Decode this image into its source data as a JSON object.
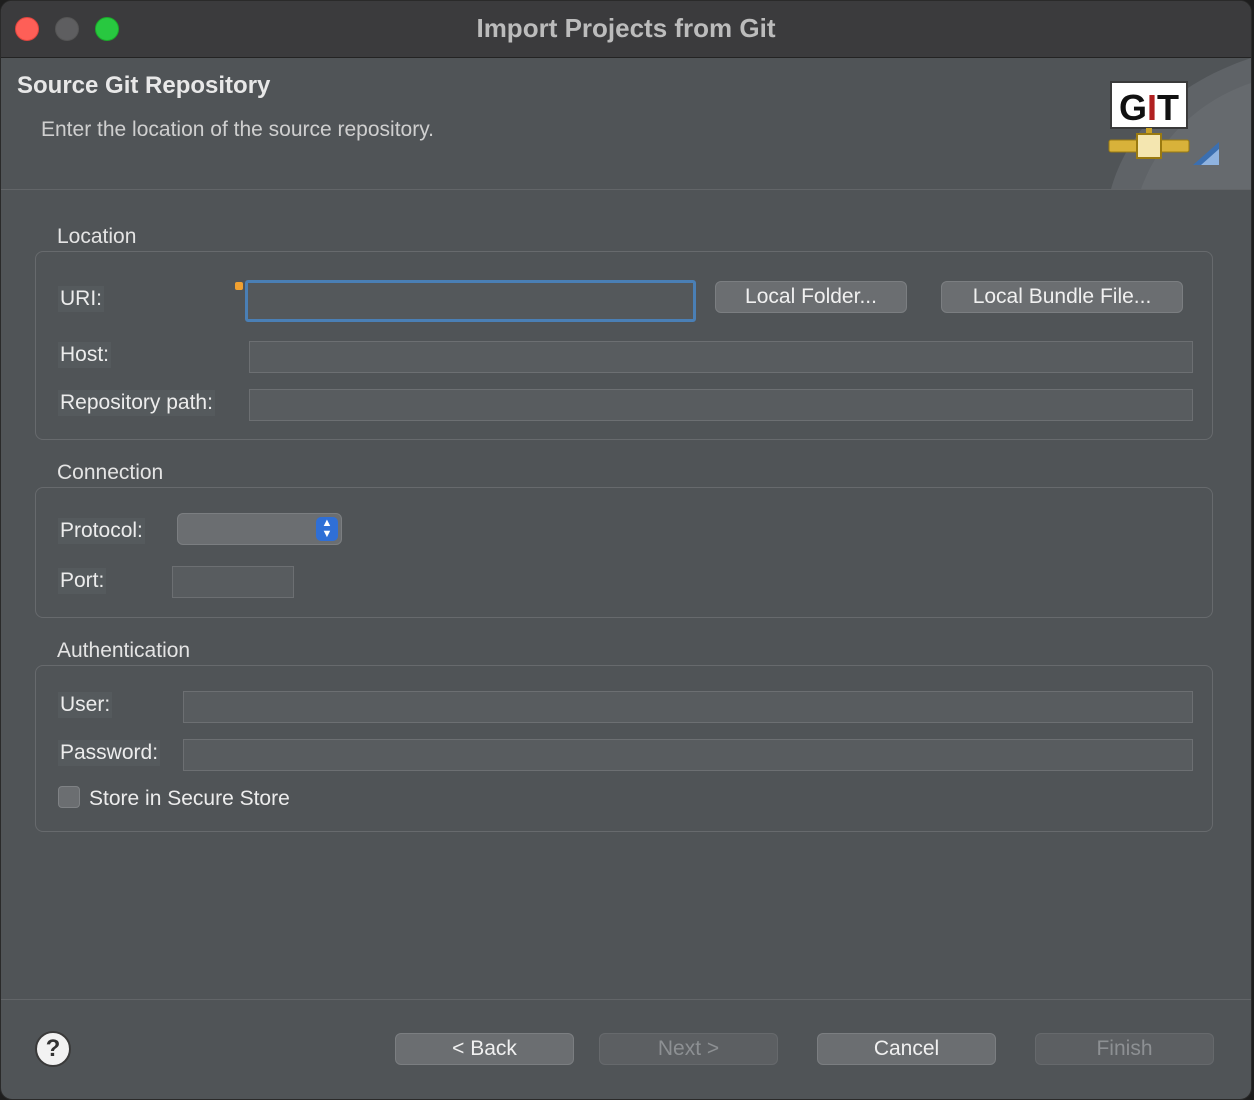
{
  "window": {
    "title": "Import Projects from Git"
  },
  "header": {
    "title": "Source Git Repository",
    "description": "Enter the location of the source repository.",
    "logo_text": "GIT"
  },
  "location": {
    "label": "Location",
    "uri_label": "URI:",
    "uri_value": "",
    "host_label": "Host:",
    "host_value": "",
    "repo_path_label": "Repository path:",
    "repo_path_value": "",
    "local_folder_button": "Local Folder...",
    "local_bundle_button": "Local Bundle File..."
  },
  "connection": {
    "label": "Connection",
    "protocol_label": "Protocol:",
    "protocol_value": "",
    "port_label": "Port:",
    "port_value": ""
  },
  "authentication": {
    "label": "Authentication",
    "user_label": "User:",
    "user_value": "",
    "password_label": "Password:",
    "password_value": "",
    "secure_store_label": "Store in Secure Store",
    "secure_store_checked": false
  },
  "footer": {
    "help": "?",
    "back_button": "< Back",
    "next_button": "Next >",
    "cancel_button": "Cancel",
    "finish_button": "Finish"
  },
  "colors": {
    "close": "#fe5f57",
    "minimize": "#5e5e60",
    "maximize": "#28c840",
    "focus_ring": "#4a7fb5",
    "select_accent": "#2f6fd6"
  }
}
